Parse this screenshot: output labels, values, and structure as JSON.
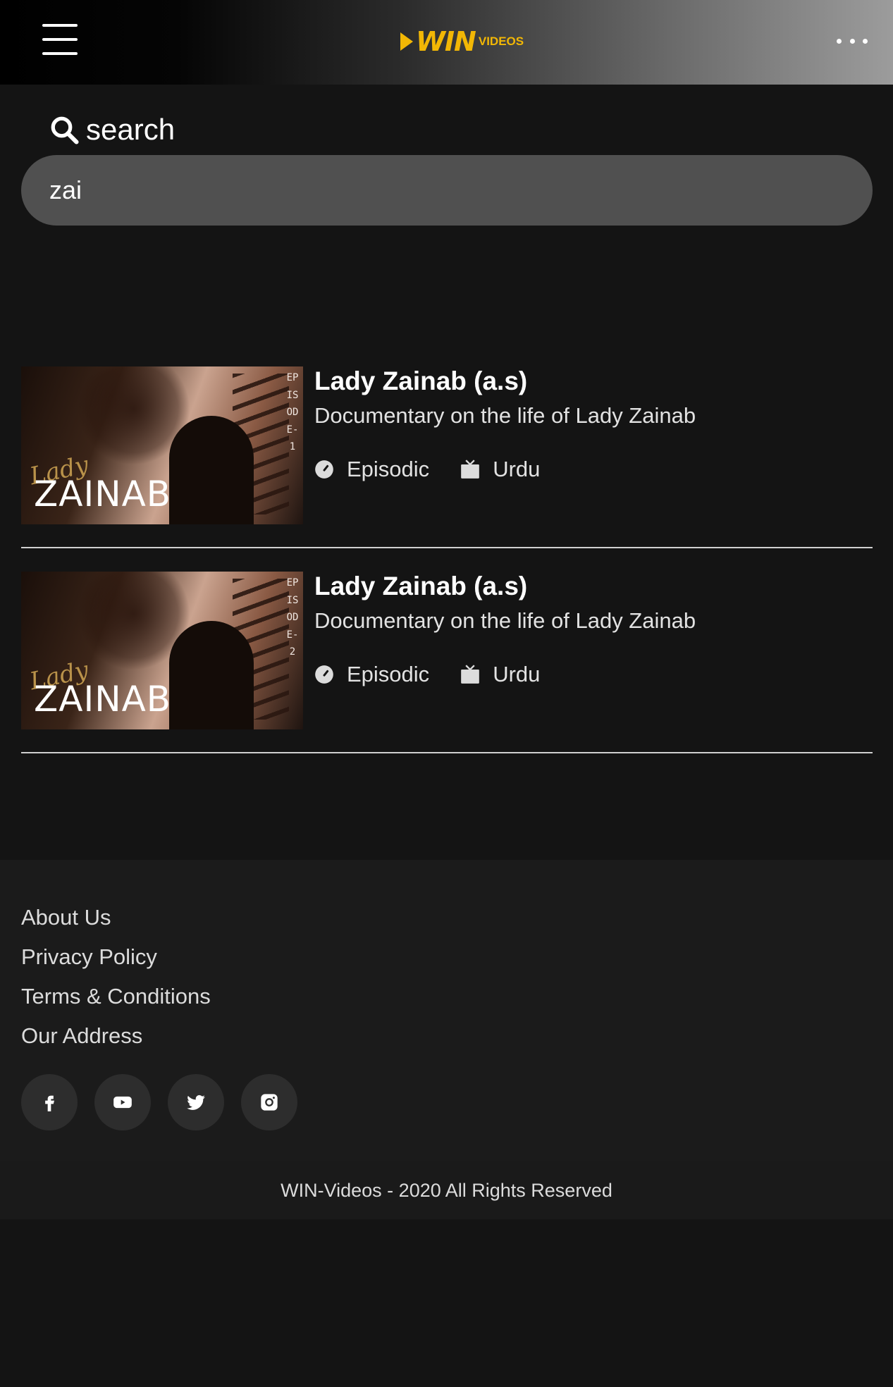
{
  "header": {
    "logo_main": "WIN",
    "logo_sub": "VIDEOS",
    "menu_icon": "hamburger-icon",
    "more_icon": "more-horizontal-icon"
  },
  "search": {
    "label": "search",
    "value": "zai",
    "icon": "search-icon"
  },
  "results": [
    {
      "title": "Lady Zainab (a.s)",
      "description": "Documentary on the life of Lady Zainab",
      "type": "Episodic",
      "language": "Urdu",
      "thumb_script": "Lady",
      "thumb_title": "ZAINAB",
      "thumb_episode": "EPISODE-1"
    },
    {
      "title": "Lady Zainab (a.s)",
      "description": "Documentary on the life of Lady Zainab",
      "type": "Episodic",
      "language": "Urdu",
      "thumb_script": "Lady",
      "thumb_title": "ZAINAB",
      "thumb_episode": "EPISODE-2"
    }
  ],
  "footer": {
    "links": [
      "About Us",
      "Privacy Policy",
      "Terms & Conditions",
      "Our Address"
    ],
    "social": [
      "facebook-icon",
      "youtube-icon",
      "twitter-icon",
      "instagram-icon"
    ],
    "copyright": "WIN-Videos - 2020 All Rights Reserved"
  },
  "colors": {
    "background": "#141414",
    "accent": "#f2b705",
    "search_bg": "#505050"
  }
}
